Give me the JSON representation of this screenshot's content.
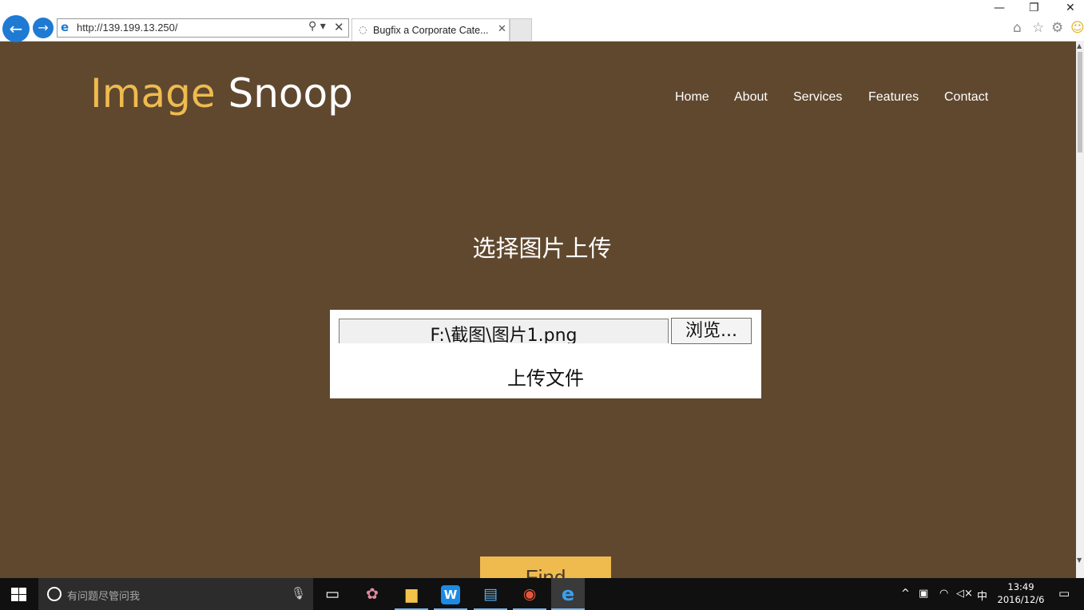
{
  "browser": {
    "url": "http://139.199.13.250/",
    "tab_title": "Bugfix a Corporate Cate...",
    "back_glyph": "←",
    "forward_glyph": "→",
    "search_glyph": "⚲ ▾",
    "close_glyph": "✕",
    "tab_close_glyph": "✕",
    "spinner_glyph": "◌",
    "window_controls": [
      "—",
      "❐",
      "✕"
    ],
    "toolbar_icons": [
      "home-icon",
      "favorites-star-icon",
      "settings-gear-icon",
      "feedback-smiley-icon"
    ],
    "toolbar_glyphs": [
      "⌂",
      "☆",
      "⚙",
      "☺"
    ]
  },
  "page": {
    "logo": {
      "word1": "Image",
      "word2": "Snoop"
    },
    "nav": [
      "Home",
      "About",
      "Services",
      "Features",
      "Contact"
    ],
    "heading": "选择图片上传",
    "file_value": "F:\\截图\\图片1.png",
    "browse_label": "浏览...",
    "upload_label": "上传文件",
    "find_label": "Find"
  },
  "taskbar": {
    "search_placeholder": "有问题尽管问我",
    "mic_glyph": "🎙",
    "apps": [
      {
        "name": "task-view-icon",
        "glyph": "▭"
      },
      {
        "name": "photo-app-icon",
        "glyph": "✿"
      },
      {
        "name": "file-explorer-icon",
        "glyph": "▆"
      },
      {
        "name": "wps-icon",
        "glyph": "W"
      },
      {
        "name": "messaging-icon",
        "glyph": "▤"
      },
      {
        "name": "color-wheel-icon",
        "glyph": "◉"
      },
      {
        "name": "internet-explorer-icon",
        "glyph": "e"
      }
    ],
    "tray_glyphs": [
      "^",
      "▣",
      "◠",
      "◁×",
      "中"
    ],
    "time": "13:49",
    "date": "2016/12/6",
    "notification_glyph": "▭"
  },
  "colors": {
    "page_bg": "#60482f",
    "accent": "#efbb4f",
    "ie_blue": "#1f7ad3"
  }
}
